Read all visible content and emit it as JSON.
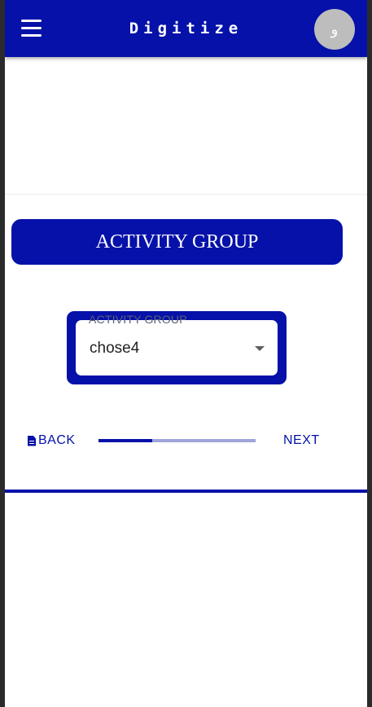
{
  "app": {
    "title": "Digitize",
    "avatar_initial": "و"
  },
  "card": {
    "header": "ACTIVITY GROUP",
    "select": {
      "label": "ACTIVITY GROUP",
      "value": "chose4"
    }
  },
  "navigation": {
    "back_label": "BACK",
    "next_label": "NEXT",
    "progress": 0.34
  },
  "colors": {
    "primary": "#0511a8",
    "progress_track": "#9fa4d9",
    "avatar_bg": "#bdbdbd"
  },
  "icons": {
    "menu": "hamburger-menu-icon",
    "back": "document-icon",
    "select_arrow": "caret-down-icon"
  }
}
